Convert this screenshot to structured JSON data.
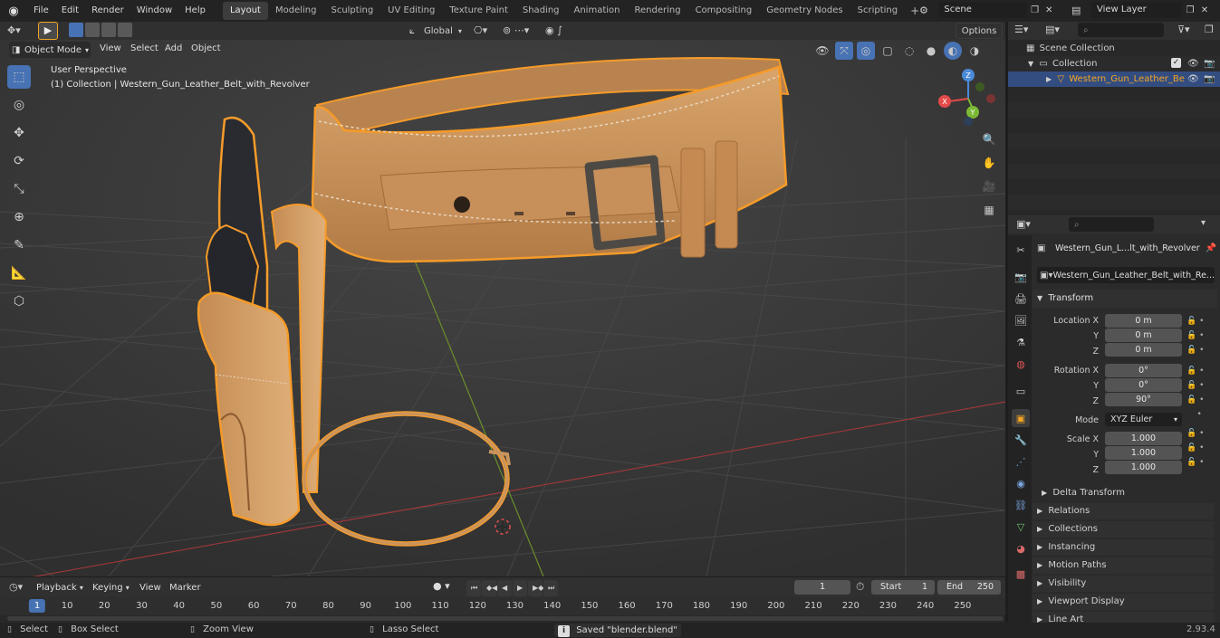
{
  "topbar": {
    "menu": [
      "File",
      "Edit",
      "Render",
      "Window",
      "Help"
    ],
    "workspaces": [
      "Layout",
      "Modeling",
      "Sculpting",
      "UV Editing",
      "Texture Paint",
      "Shading",
      "Animation",
      "Rendering",
      "Compositing",
      "Geometry Nodes",
      "Scripting"
    ],
    "active_workspace": "Layout",
    "scene": "Scene",
    "view_layer": "View Layer"
  },
  "viewport_header": {
    "mode": "Object Mode",
    "menus": [
      "View",
      "Select",
      "Add",
      "Object"
    ],
    "orientation": "Global",
    "options": "Options"
  },
  "viewport": {
    "perspective": "User Perspective",
    "collection_info": "(1) Collection | Western_Gun_Leather_Belt_with_Revolver",
    "gizmo_axes": {
      "x": "X",
      "y": "Y",
      "z": "Z"
    }
  },
  "outliner": {
    "scene_collection": "Scene Collection",
    "collection": "Collection",
    "object": "Western_Gun_Leather_Be"
  },
  "properties": {
    "object_name": "Western_Gun_L...lt_with_Revolver",
    "data_name": "Western_Gun_Leather_Belt_with_Re...",
    "transform": {
      "title": "Transform",
      "location_label": "Location X",
      "location": [
        "0 m",
        "0 m",
        "0 m"
      ],
      "rotation_label": "Rotation X",
      "rotation": [
        "0°",
        "0°",
        "90°"
      ],
      "mode_label": "Mode",
      "mode": "XYZ Euler",
      "scale_label": "Scale X",
      "scale": [
        "1.000",
        "1.000",
        "1.000"
      ],
      "y": "Y",
      "z": "Z"
    },
    "sections": [
      "Delta Transform",
      "Relations",
      "Collections",
      "Instancing",
      "Motion Paths",
      "Visibility",
      "Viewport Display",
      "Line Art"
    ]
  },
  "timeline": {
    "menus": [
      "Playback",
      "Keying",
      "View",
      "Marker"
    ],
    "current_frame": "1",
    "start_label": "Start",
    "start": "1",
    "end_label": "End",
    "end": "250",
    "ticks": [
      "1",
      "10",
      "20",
      "30",
      "40",
      "50",
      "60",
      "70",
      "80",
      "90",
      "100",
      "110",
      "120",
      "130",
      "140",
      "150",
      "160",
      "170",
      "180",
      "190",
      "200",
      "210",
      "220",
      "230",
      "240",
      "250"
    ]
  },
  "statusbar": {
    "select": "Select",
    "box_select": "Box Select",
    "zoom_view": "Zoom View",
    "lasso_select": "Lasso Select",
    "message": "Saved \"blender.blend\"",
    "version": "2.93.4"
  },
  "colors": {
    "accent": "#4772b3",
    "selection_outline": "#f59b2a",
    "leather": "#c9945e",
    "x_axis": "#e34a4a",
    "y_axis": "#7bb934",
    "z_axis": "#4a8ad8"
  }
}
